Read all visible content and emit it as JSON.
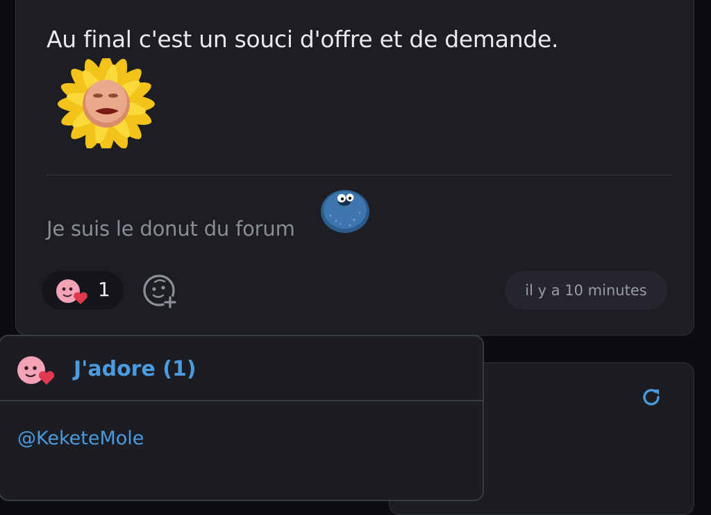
{
  "post": {
    "text": "Au final c'est un souci d'offre et de demande.",
    "signature": "Je suis le donut du forum",
    "time": "il y a 10 minutes"
  },
  "reactions": {
    "icon": "heart-face-emoji",
    "count": "1",
    "add_icon": "add-reaction-icon"
  },
  "popover": {
    "title": "J'adore (1)",
    "users": [
      "@KeketeMole"
    ]
  },
  "colors": {
    "accent": "#4a9be0",
    "card": "#1d1e24",
    "page": "#0c0d10"
  }
}
